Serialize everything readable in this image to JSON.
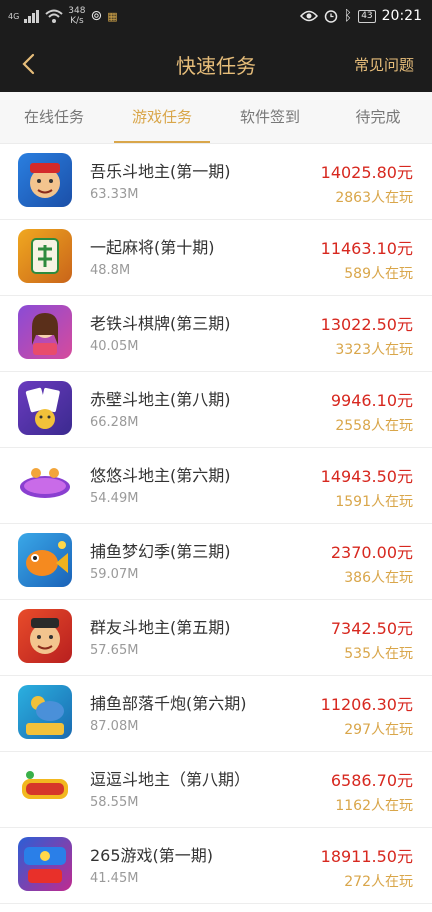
{
  "status_bar": {
    "signal_label": "4G",
    "speed_value": "348",
    "speed_unit": "K/s",
    "battery": "43",
    "time": "20:21"
  },
  "header": {
    "title": "快速任务",
    "faq_label": "常见问题",
    "accent_color": "#e6bd7a"
  },
  "tabs": [
    {
      "label": "在线任务"
    },
    {
      "label": "游戏任务"
    },
    {
      "label": "软件签到"
    },
    {
      "label": "待完成"
    }
  ],
  "games": [
    {
      "name": "吾乐斗地主(第一期)",
      "size": "63.33M",
      "reward": "14025.80元",
      "players": "2863人在玩",
      "icon": "landlord-icon"
    },
    {
      "name": "一起麻将(第十期)",
      "size": "48.8M",
      "reward": "11463.10元",
      "players": "589人在玩",
      "icon": "mahjong-icon"
    },
    {
      "name": "老铁斗棋牌(第三期)",
      "size": "40.05M",
      "reward": "13022.50元",
      "players": "3323人在玩",
      "icon": "chess-card-icon"
    },
    {
      "name": "赤壁斗地主(第八期)",
      "size": "66.28M",
      "reward": "9946.10元",
      "players": "2558人在玩",
      "icon": "poker-cards-icon"
    },
    {
      "name": "悠悠斗地主(第六期)",
      "size": "54.49M",
      "reward": "14943.50元",
      "players": "1591人在玩",
      "icon": "logo-icon"
    },
    {
      "name": "捕鱼梦幻季(第三期)",
      "size": "59.07M",
      "reward": "2370.00元",
      "players": "386人在玩",
      "icon": "fish-icon"
    },
    {
      "name": "群友斗地主(第五期)",
      "size": "57.65M",
      "reward": "7342.50元",
      "players": "535人在玩",
      "icon": "landlord-icon"
    },
    {
      "name": "捕鱼部落千炮(第六期)",
      "size": "87.08M",
      "reward": "11206.30元",
      "players": "297人在玩",
      "icon": "fishing-cannon-icon"
    },
    {
      "name": "逗逗斗地主（第八期）",
      "size": "58.55M",
      "reward": "6586.70元",
      "players": "1162人在玩",
      "icon": "logo-icon"
    },
    {
      "name": "265游戏(第一期)",
      "size": "41.45M",
      "reward": "18911.50元",
      "players": "272人在玩",
      "icon": "game-265-icon"
    }
  ]
}
